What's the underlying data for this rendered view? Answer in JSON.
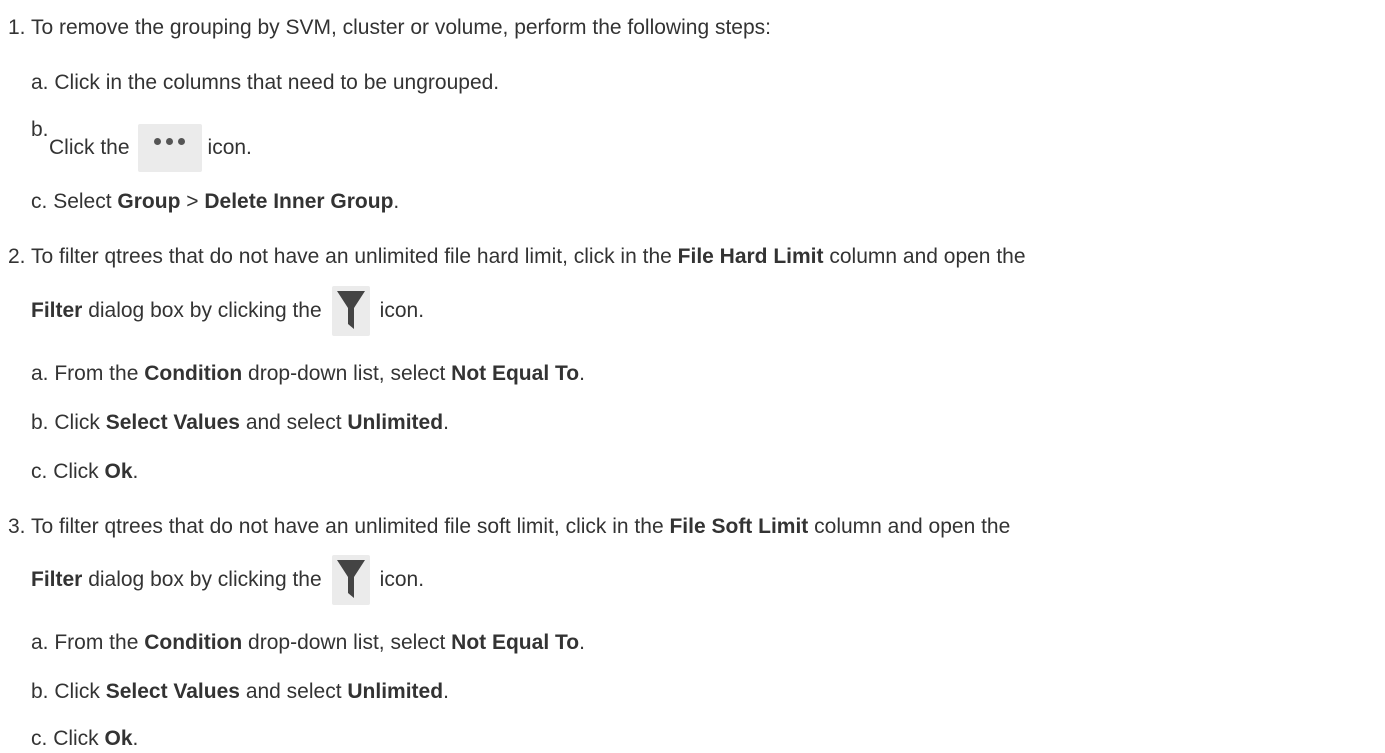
{
  "steps": [
    {
      "marker": "1.",
      "text": "To remove the grouping by SVM, cluster or volume, perform the following steps:",
      "substeps": [
        {
          "marker": "a.",
          "text": "Click in the columns that need to be ungrouped."
        },
        {
          "marker": "b.",
          "pre": "Click the",
          "icon": "more-options-icon",
          "post": "icon."
        },
        {
          "marker": "c.",
          "pre": "Select",
          "b1": "Group",
          "sep": ">",
          "b2": "Delete Inner Group",
          "post": "."
        }
      ]
    },
    {
      "marker": "2.",
      "pre": "To filter qtrees that do not have an unlimited file hard limit, click in the",
      "bold": "File Hard Limit",
      "post": "column and open the",
      "line2_bold": "Filter",
      "line2_pre": "dialog box by clicking the",
      "icon": "filter-icon",
      "line2_post": "icon.",
      "substeps": [
        {
          "marker": "a.",
          "pre": "From the",
          "b1": "Condition",
          "mid": "drop-down list, select",
          "b2": "Not Equal To",
          "post": "."
        },
        {
          "marker": "b.",
          "pre": "Click",
          "b1": "Select Values",
          "mid": "and select",
          "b2": "Unlimited",
          "post": "."
        },
        {
          "marker": "c.",
          "pre": "Click",
          "b1": "Ok",
          "post": "."
        }
      ]
    },
    {
      "marker": "3.",
      "pre": "To filter qtrees that do not have an unlimited file soft limit, click in the",
      "bold": "File Soft Limit",
      "post": "column and open the",
      "line2_bold": "Filter",
      "line2_pre": "dialog box by clicking the",
      "icon": "filter-icon",
      "line2_post": "icon.",
      "substeps": [
        {
          "marker": "a.",
          "pre": "From the",
          "b1": "Condition",
          "mid": "drop-down list, select",
          "b2": "Not Equal To",
          "post": "."
        },
        {
          "marker": "b.",
          "pre": "Click",
          "b1": "Select Values",
          "mid": "and select",
          "b2": "Unlimited",
          "post": "."
        },
        {
          "marker": "c.",
          "pre": "Click",
          "b1": "Ok",
          "post": "."
        }
      ]
    }
  ]
}
